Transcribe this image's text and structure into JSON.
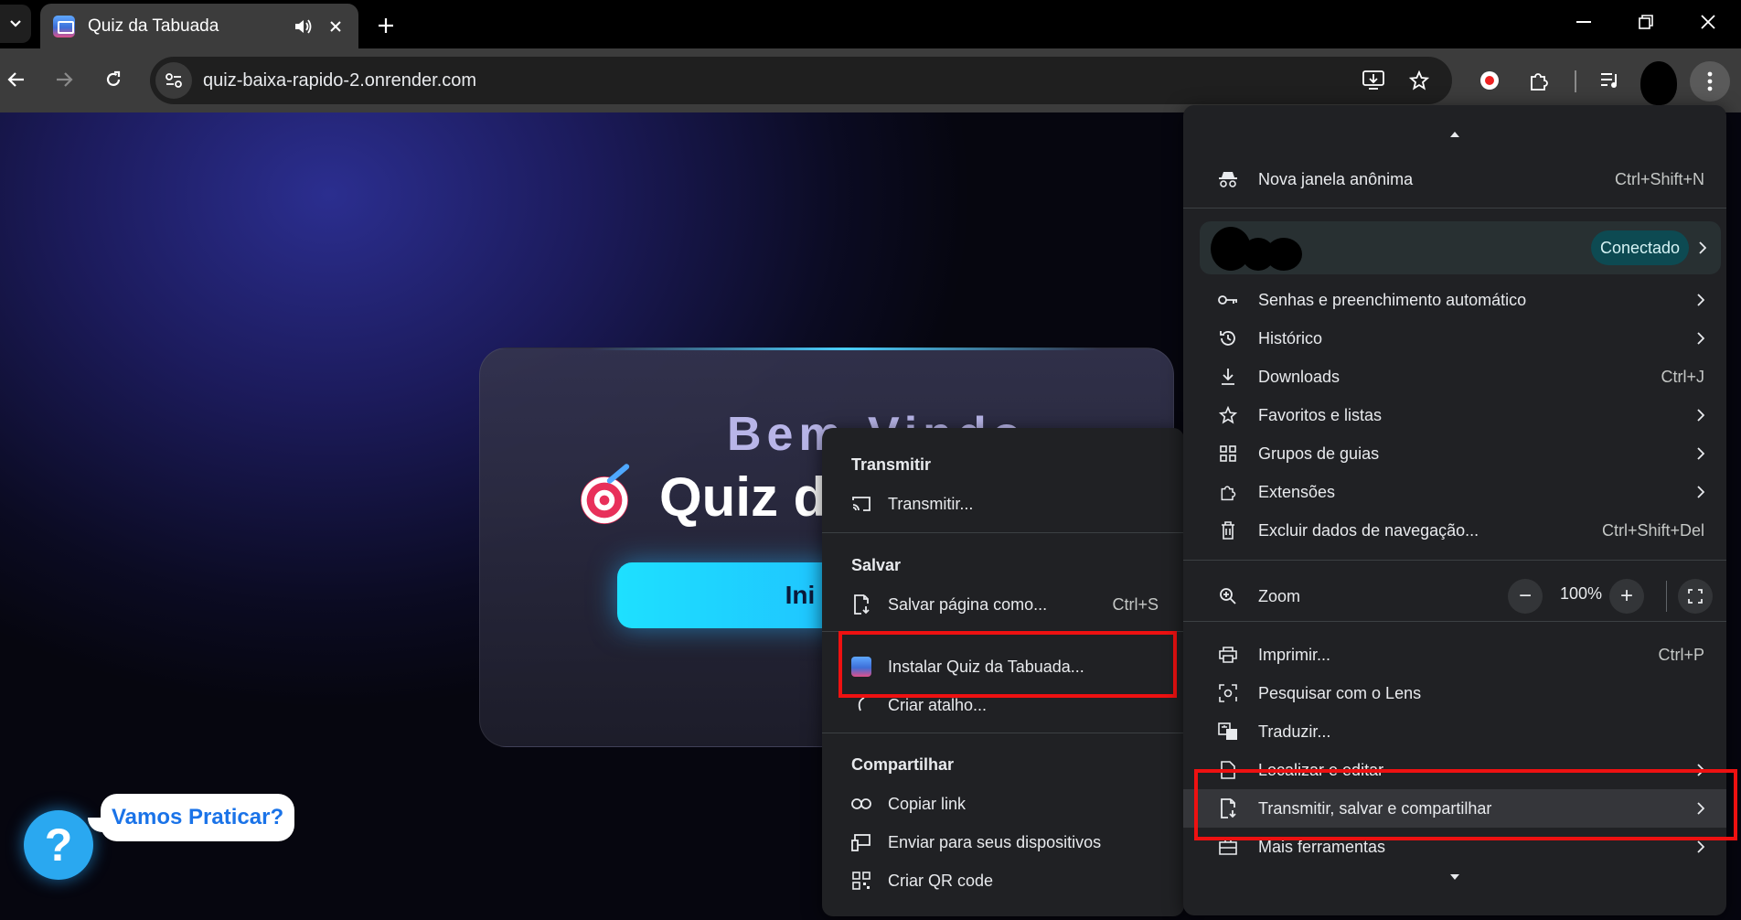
{
  "tab": {
    "title": "Quiz da Tabuada"
  },
  "toolbar": {
    "url": "quiz-baixa-rapido-2.onrender.com"
  },
  "page": {
    "welcome": "Bem-Vindo",
    "title": "Quiz da",
    "start_button": "Ini",
    "help_symbol": "?",
    "help_tip": "Vamos Praticar?"
  },
  "menu": {
    "incognito": {
      "label": "Nova janela anônima",
      "shortcut": "Ctrl+Shift+N"
    },
    "profile_badge": "Conectado",
    "passwords": "Senhas e preenchimento automático",
    "history": "Histórico",
    "downloads": {
      "label": "Downloads",
      "shortcut": "Ctrl+J"
    },
    "bookmarks": "Favoritos e listas",
    "tab_groups": "Grupos de guias",
    "extensions": "Extensões",
    "clear_data": {
      "label": "Excluir dados de navegação...",
      "shortcut": "Ctrl+Shift+Del"
    },
    "zoom": {
      "label": "Zoom",
      "value": "100%",
      "minus": "−",
      "plus": "+"
    },
    "print": {
      "label": "Imprimir...",
      "shortcut": "Ctrl+P"
    },
    "lens": "Pesquisar com o Lens",
    "translate": "Traduzir...",
    "find": "Localizar e editar",
    "cast_save_share": "Transmitir, salvar e compartilhar",
    "more_tools": "Mais ferramentas"
  },
  "submenu": {
    "cast_header": "Transmitir",
    "cast": "Transmitir...",
    "save_header": "Salvar",
    "save_page": {
      "label": "Salvar página como...",
      "shortcut": "Ctrl+S"
    },
    "install": "Instalar Quiz da Tabuada...",
    "shortcut": "Criar atalho...",
    "share_header": "Compartilhar",
    "copy_link": "Copiar link",
    "send_devices": "Enviar para seus dispositivos",
    "qr": "Criar QR code"
  },
  "colors": {
    "highlight": "#ee1111",
    "accent": "#1ee0ff",
    "menu_bg": "#202124"
  }
}
